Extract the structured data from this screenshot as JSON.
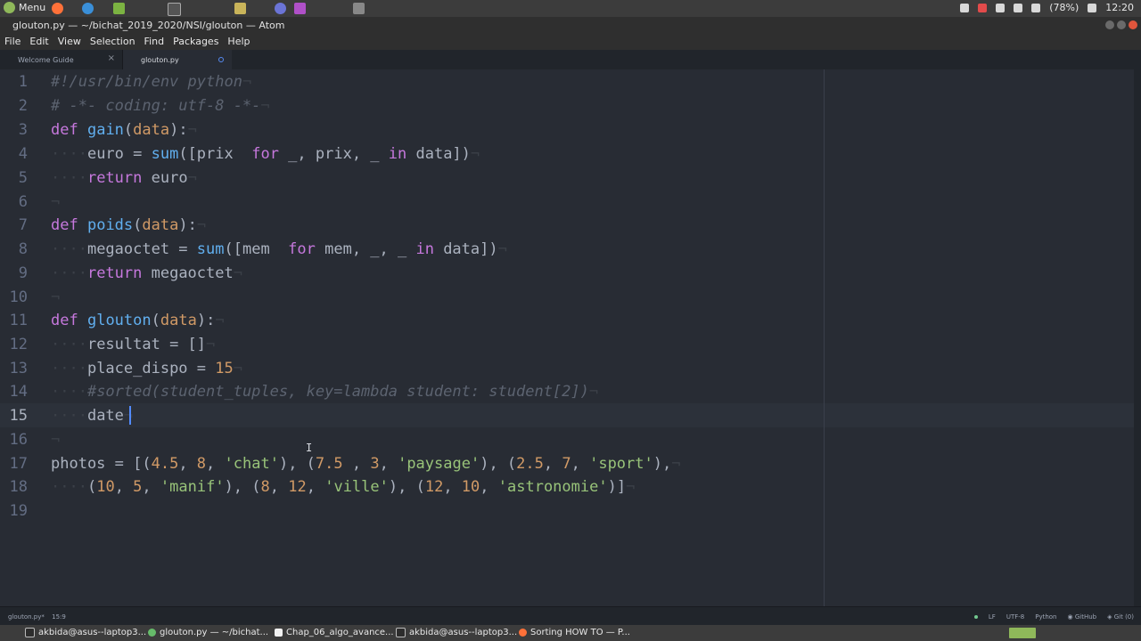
{
  "system_panel": {
    "menu_label": "Menu",
    "battery": "(78%)",
    "clock": "12:20"
  },
  "window": {
    "title": "glouton.py — ~/bichat_2019_2020/NSI/glouton — Atom"
  },
  "menubar": [
    "File",
    "Edit",
    "View",
    "Selection",
    "Find",
    "Packages",
    "Help"
  ],
  "tabs": [
    {
      "label": "Welcome Guide",
      "active": false
    },
    {
      "label": "glouton.py",
      "active": true,
      "modified": true
    }
  ],
  "editor": {
    "language": "Python",
    "cursor_line": 15,
    "lines": [
      {
        "n": "1",
        "text": "#!/usr/bin/env python"
      },
      {
        "n": "2",
        "text": "# -*- coding: utf-8 -*-"
      },
      {
        "n": "3",
        "text": "def gain(data):"
      },
      {
        "n": "4",
        "text": "    euro = sum([prix  for _, prix, _ in data])"
      },
      {
        "n": "5",
        "text": "    return euro"
      },
      {
        "n": "6",
        "text": ""
      },
      {
        "n": "7",
        "text": "def poids(data):"
      },
      {
        "n": "8",
        "text": "    megaoctet = sum([mem  for mem, _, _ in data])"
      },
      {
        "n": "9",
        "text": "    return megaoctet"
      },
      {
        "n": "10",
        "text": ""
      },
      {
        "n": "11",
        "text": "def glouton(data):"
      },
      {
        "n": "12",
        "text": "    resultat = []"
      },
      {
        "n": "13",
        "text": "    place_dispo = 15"
      },
      {
        "n": "14",
        "text": "    #sorted(student_tuples, key=lambda student: student[2])"
      },
      {
        "n": "15",
        "text": "    date"
      },
      {
        "n": "16",
        "text": ""
      },
      {
        "n": "17",
        "text": "photos = [(4.5, 8, 'chat'), (7.5 , 3, 'paysage'), (2.5, 7, 'sport'),"
      },
      {
        "n": "18",
        "text": "    (10, 5, 'manif'), (8, 12, 'ville'), (12, 10, 'astronomie')]"
      },
      {
        "n": "19",
        "text": ""
      }
    ]
  },
  "statusbar": {
    "file": "glouton.py*",
    "position": "15:9",
    "line_ending": "LF",
    "encoding": "UTF-8",
    "grammar": "Python",
    "github": "GitHub",
    "git": "Git (0)"
  },
  "taskbar": [
    {
      "label": "akbida@asus--laptop3...",
      "icon_color": "#2d2d2d"
    },
    {
      "label": "glouton.py — ~/bichat...",
      "icon_color": "#66bb6a"
    },
    {
      "label": "Chap_06_algo_avance...",
      "icon_color": "#f2f2f2"
    },
    {
      "label": "akbida@asus--laptop3...",
      "icon_color": "#2d2d2d"
    },
    {
      "label": "Sorting HOW TO — P...",
      "icon_color": "#ff7139"
    }
  ],
  "colors": {
    "keyword": "#c678dd",
    "function": "#61afef",
    "number": "#d19a66",
    "string": "#98c379",
    "comment": "#5c6370"
  }
}
